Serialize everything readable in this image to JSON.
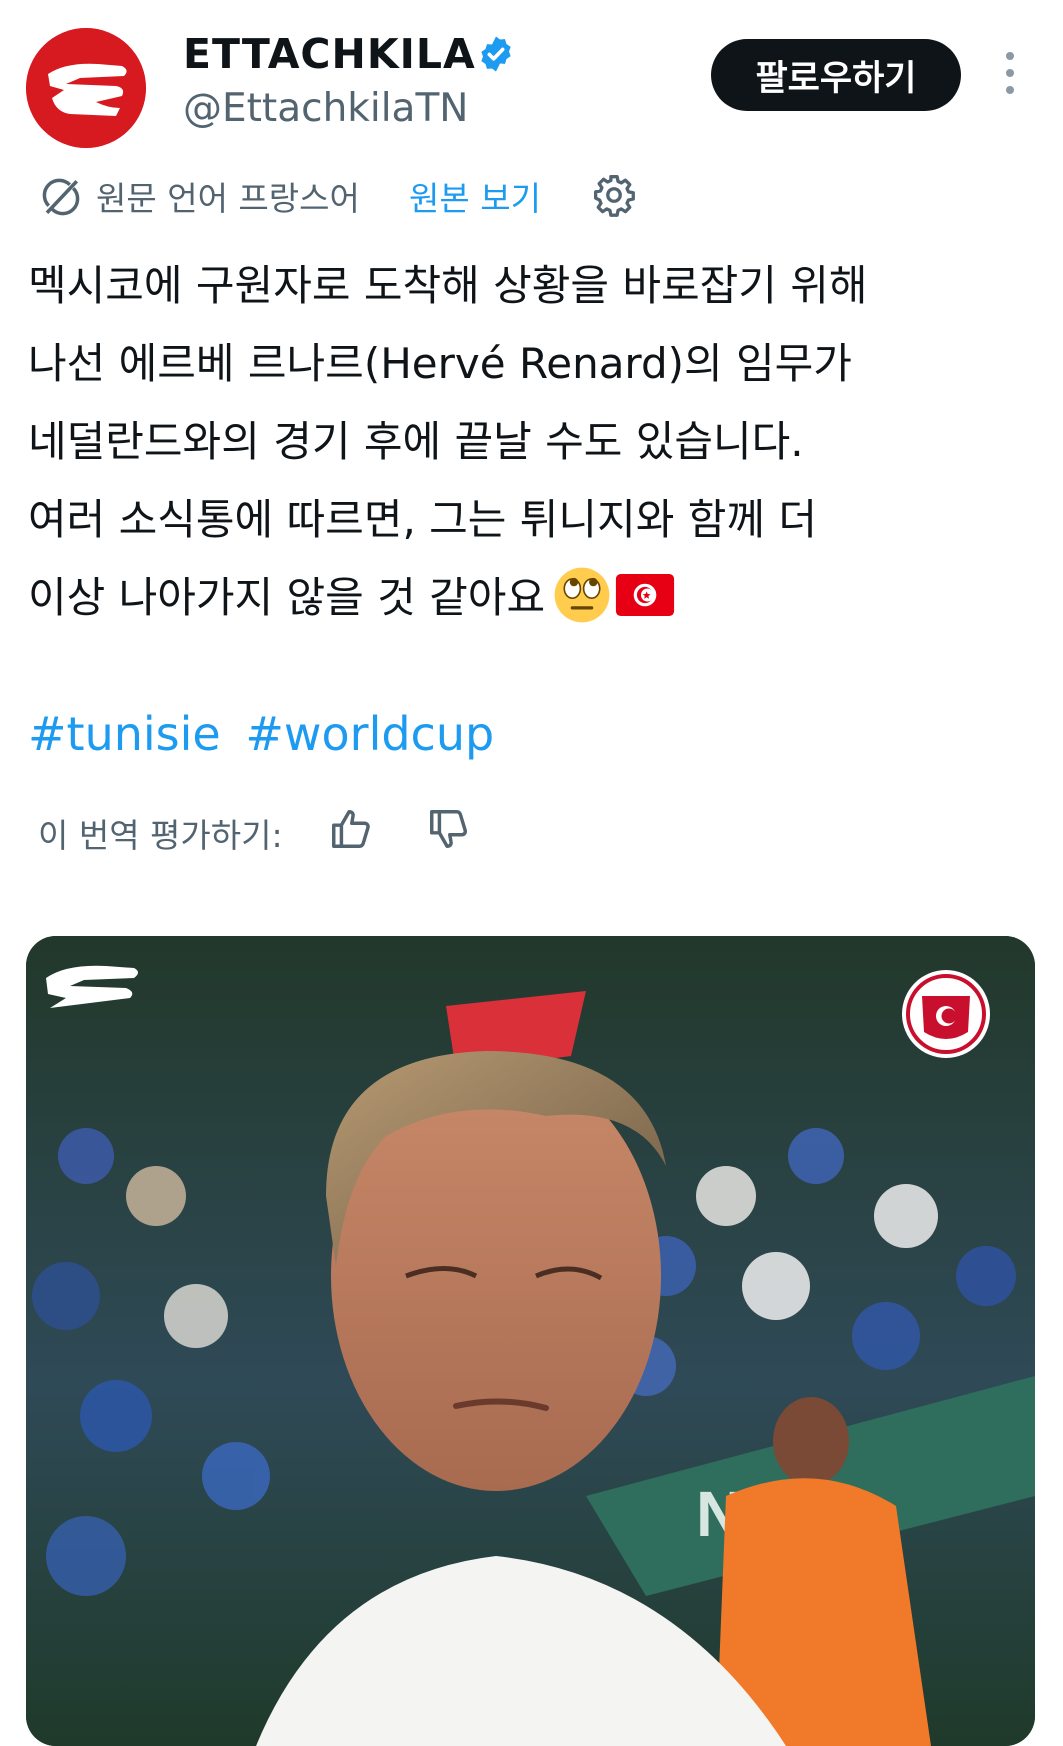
{
  "account": {
    "display_name": "ETTACHKILA",
    "handle": "@EttachkilaTN",
    "verified_icon": "verified-badge-icon",
    "avatar_color": "#d71920"
  },
  "header": {
    "follow_label": "팔로우하기",
    "more_icon": "more-vertical-icon"
  },
  "translation": {
    "source_language": "원문 언어 프랑스어",
    "show_original_label": "원본 보기",
    "settings_icon": "gear-icon"
  },
  "tweet": {
    "lines": [
      "멕시코에 구원자로 도착해 상황을 바로잡기 위해",
      "나선 에르베 르나르(Hervé Renard)의 임무가",
      "네덜란드와의 경기 후에 끝날 수도 있습니다.",
      "여러 소식통에 따르면, 그는 튀니지와 함께 더",
      "이상 나아가지 않을 것 같아요"
    ],
    "emoji": [
      "eye-roll-face-icon",
      "tunisia-flag-icon"
    ],
    "hashtags": [
      "#tunisie",
      "#worldcup"
    ]
  },
  "rating": {
    "label": "이 번역 평가하기:",
    "thumb_up_icon": "thumb-up-icon",
    "thumb_down_icon": "thumb-down-icon"
  },
  "media": {
    "overlay_text": "NTEF",
    "logo_icon": "ettachkila-logo-icon",
    "crest_icon": "tunisian-football-federation-crest-icon"
  },
  "colors": {
    "accent": "#1d9bf0",
    "text_primary": "#0f1419",
    "text_secondary": "#536471",
    "button_dark": "#0f1419"
  }
}
